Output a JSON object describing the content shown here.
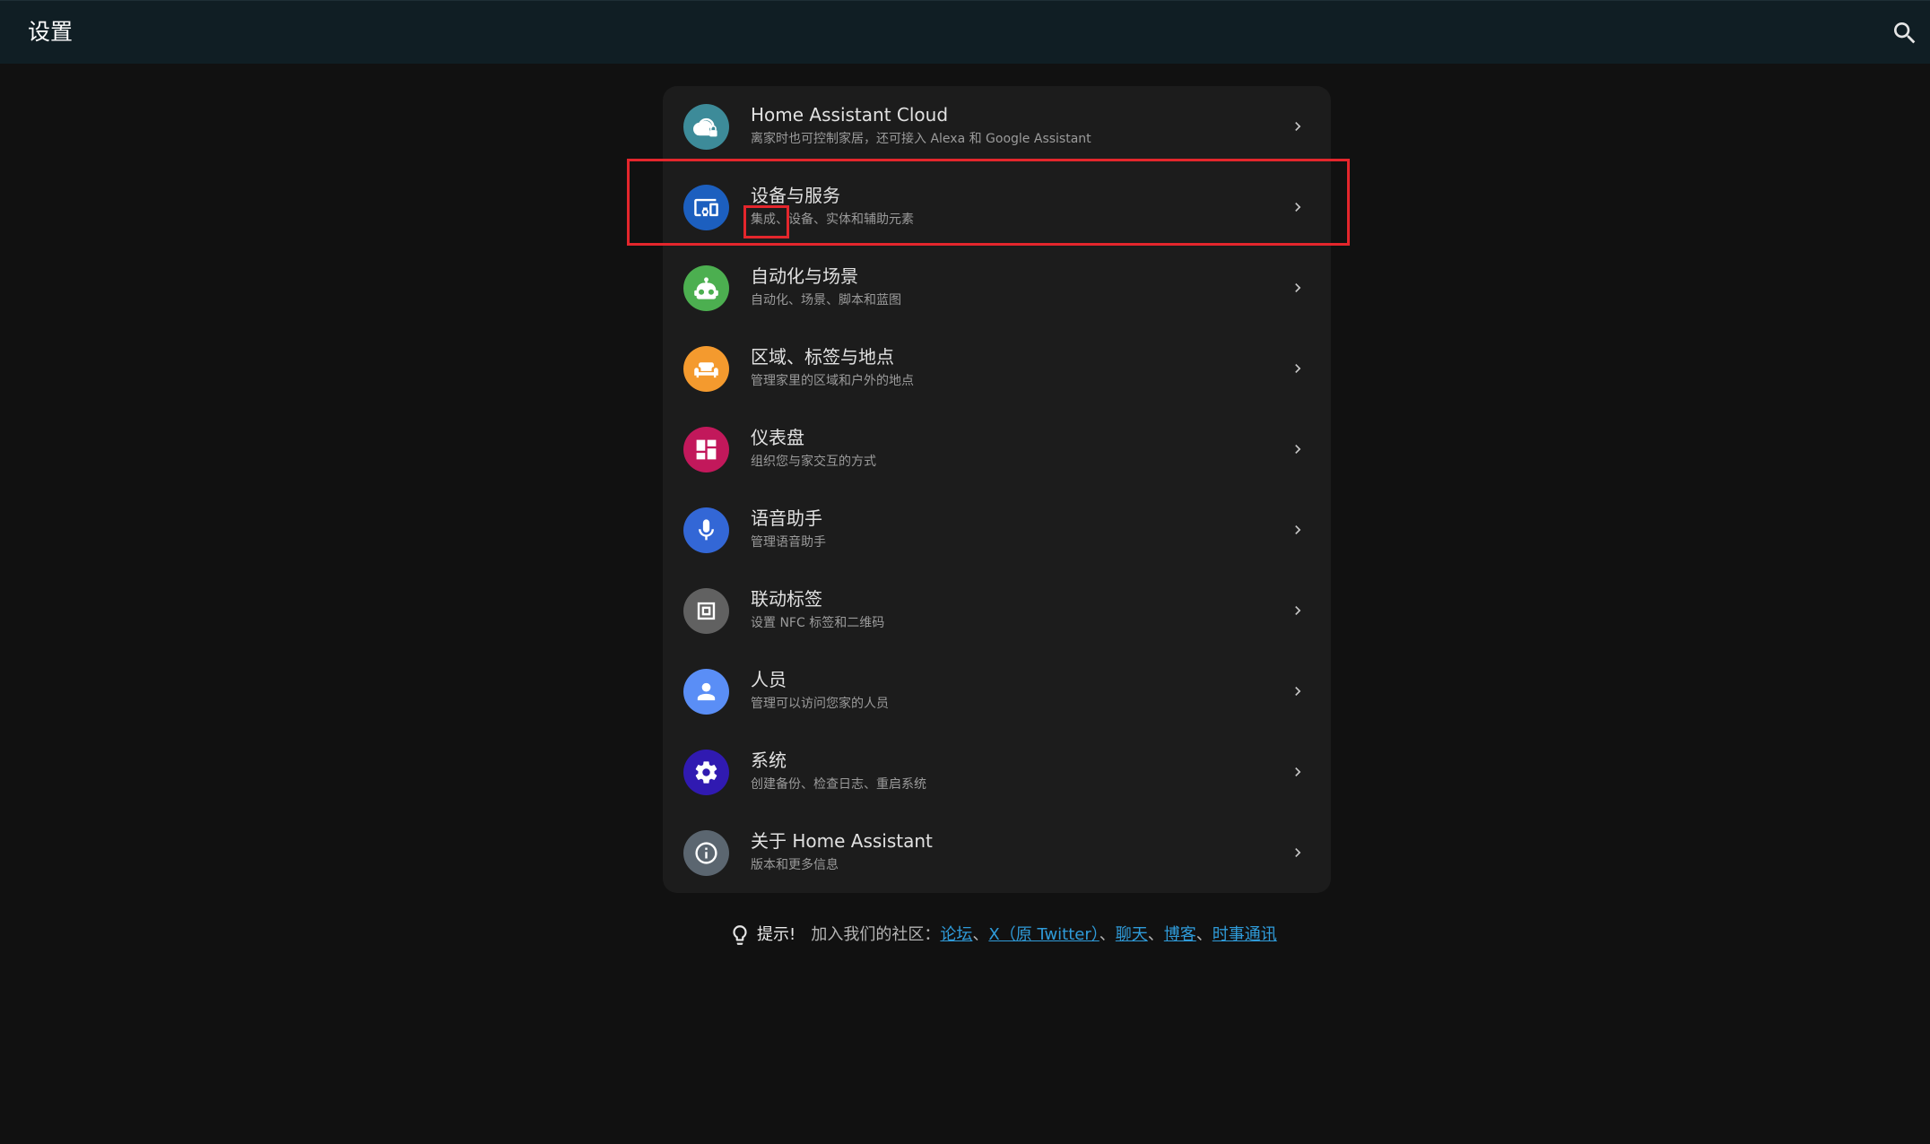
{
  "header": {
    "title": "设置",
    "search_icon": "search-icon"
  },
  "colors": {
    "background": "#111111",
    "topbar": "#101e24",
    "card": "#1c1c1c",
    "link": "#2f9bd9",
    "highlight": "#e4262c"
  },
  "menu": {
    "items": [
      {
        "id": "cloud",
        "label": "Home Assistant Cloud",
        "sub": "离家时也可控制家居，还可接入 Alexa 和 Google Assistant",
        "icon": "cloud-lock-icon",
        "color": "#3d8b99"
      },
      {
        "id": "devices",
        "label": "设备与服务",
        "sub": "集成、设备、实体和辅助元素",
        "icon": "devices-icon",
        "color": "#1c5fbf"
      },
      {
        "id": "automation",
        "label": "自动化与场景",
        "sub": "自动化、场景、脚本和蓝图",
        "icon": "robot-icon",
        "color": "#4caf50"
      },
      {
        "id": "areas",
        "label": "区域、标签与地点",
        "sub": "管理家里的区域和户外的地点",
        "icon": "sofa-icon",
        "color": "#f49a2e"
      },
      {
        "id": "dashboards",
        "label": "仪表盘",
        "sub": "组织您与家交互的方式",
        "icon": "dashboard-icon",
        "color": "#c2185b"
      },
      {
        "id": "voice",
        "label": "语音助手",
        "sub": "管理语音助手",
        "icon": "microphone-icon",
        "color": "#3367d6"
      },
      {
        "id": "tags",
        "label": "联动标签",
        "sub": "设置 NFC 标签和二维码",
        "icon": "nfc-icon",
        "color": "#616161"
      },
      {
        "id": "people",
        "label": "人员",
        "sub": "管理可以访问您家的人员",
        "icon": "person-icon",
        "color": "#5a8ef6"
      },
      {
        "id": "system",
        "label": "系统",
        "sub": "创建备份、检查日志、重启系统",
        "icon": "gear-icon",
        "color": "#301ab1"
      },
      {
        "id": "about",
        "label": "关于 Home Assistant",
        "sub": "版本和更多信息",
        "icon": "info-icon",
        "color": "#5b6670"
      }
    ]
  },
  "tip": {
    "prefix": "提示!",
    "text": "加入我们的社区：",
    "links": [
      "论坛",
      "X（原 Twitter）",
      "聊天",
      "博客",
      "时事通讯"
    ],
    "separator": "、"
  }
}
